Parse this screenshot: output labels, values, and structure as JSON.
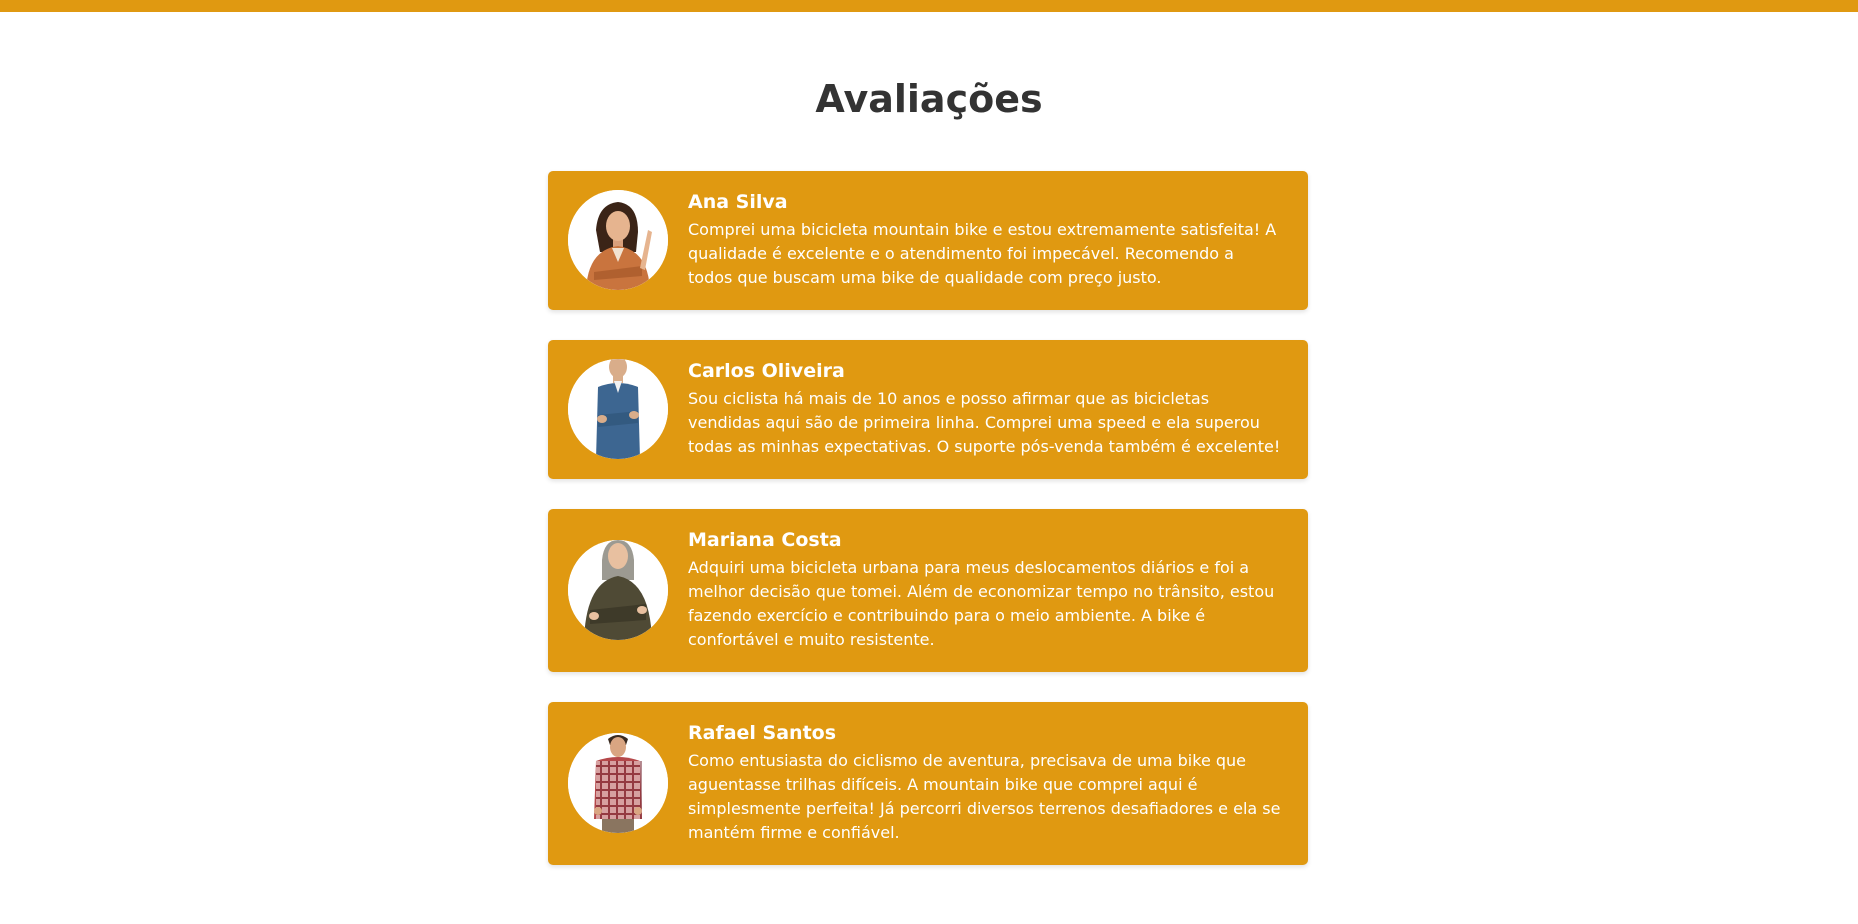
{
  "colors": {
    "accent": "#e09911",
    "title": "#333333",
    "card_text": "#ffffff",
    "background": "#ffffff"
  },
  "page": {
    "title": "Avaliações"
  },
  "reviews": [
    {
      "name": "Ana Silva",
      "text": "Comprei uma bicicleta mountain bike e estou extremamente satisfeita! A qualidade é excelente e o atendimento foi impecável. Recomendo a todos que buscam uma bike de qualidade com preço justo.",
      "avatar_icon": "person-photo-icon"
    },
    {
      "name": "Carlos Oliveira",
      "text": "Sou ciclista há mais de 10 anos e posso afirmar que as bicicletas vendidas aqui são de primeira linha. Comprei uma speed e ela superou todas as minhas expectativas. O suporte pós-venda também é excelente!",
      "avatar_icon": "person-photo-icon"
    },
    {
      "name": "Mariana Costa",
      "text": "Adquiri uma bicicleta urbana para meus deslocamentos diários e foi a melhor decisão que tomei. Além de economizar tempo no trânsito, estou fazendo exercício e contribuindo para o meio ambiente. A bike é confortável e muito resistente.",
      "avatar_icon": "person-photo-icon"
    },
    {
      "name": "Rafael Santos",
      "text": "Como entusiasta do ciclismo de aventura, precisava de uma bike que aguentasse trilhas difíceis. A mountain bike que comprei aqui é simplesmente perfeita! Já percorri diversos terrenos desafiadores e ela se mantém firme e confiável.",
      "avatar_icon": "person-photo-icon"
    }
  ]
}
